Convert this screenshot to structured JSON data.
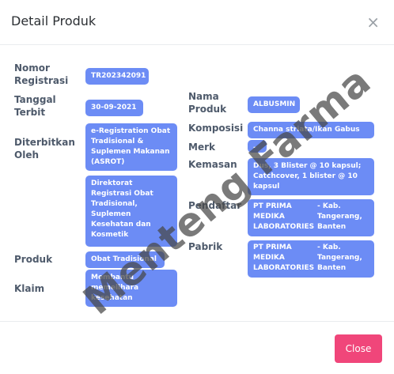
{
  "header": {
    "title": "Detail Produk",
    "close_icon": "×"
  },
  "labels": {
    "nomor_registrasi": "Nomor\nRegistrasi",
    "tanggal_terbit": "Tanggal\nTerbit",
    "diterbitkan_oleh": "Diterbitkan\nOleh",
    "produk": "Produk",
    "klaim": "Klaim",
    "nama_produk": "Nama\nProduk",
    "komposisi": "Komposisi",
    "merk": "Merk",
    "kemasan": "Kemasan",
    "pendaftar": "Pendaftar",
    "pabrik": "Pabrik"
  },
  "values": {
    "nomor_registrasi": "TR202342091",
    "tanggal_terbit": "30-09-2021",
    "diterbitkan_oleh_1": "e-Registration Obat Tradisional & Suplemen Makanan (ASROT)",
    "diterbitkan_oleh_2": "Direktorat Registrasi Obat Tradisional, Suplemen Kesehatan dan Kosmetik",
    "produk": "Obat Tradisional",
    "klaim": "Membantu memelihara kesehatan",
    "nama_produk": "ALBUSMIN",
    "komposisi": "Channa striata/Ikan Gabus",
    "merk": "-",
    "kemasan": "Dus, 3 Blister @ 10 kapsul; Catchcover, 1 blister @ 10 kapsul",
    "pendaftar_name": "PT PRIMA MEDIKA LABORATORIES",
    "pendaftar_loc": "- Kab. Tangerang, Banten",
    "pabrik_name": "PT PRIMA MEDIKA LABORATORIES",
    "pabrik_loc": "- Kab. Tangerang, Banten"
  },
  "watermark": "Menteng Farma",
  "footer": {
    "close_label": "Close"
  },
  "colors": {
    "value_bg": "#6c8cf5",
    "close_button": "#f0467a"
  }
}
